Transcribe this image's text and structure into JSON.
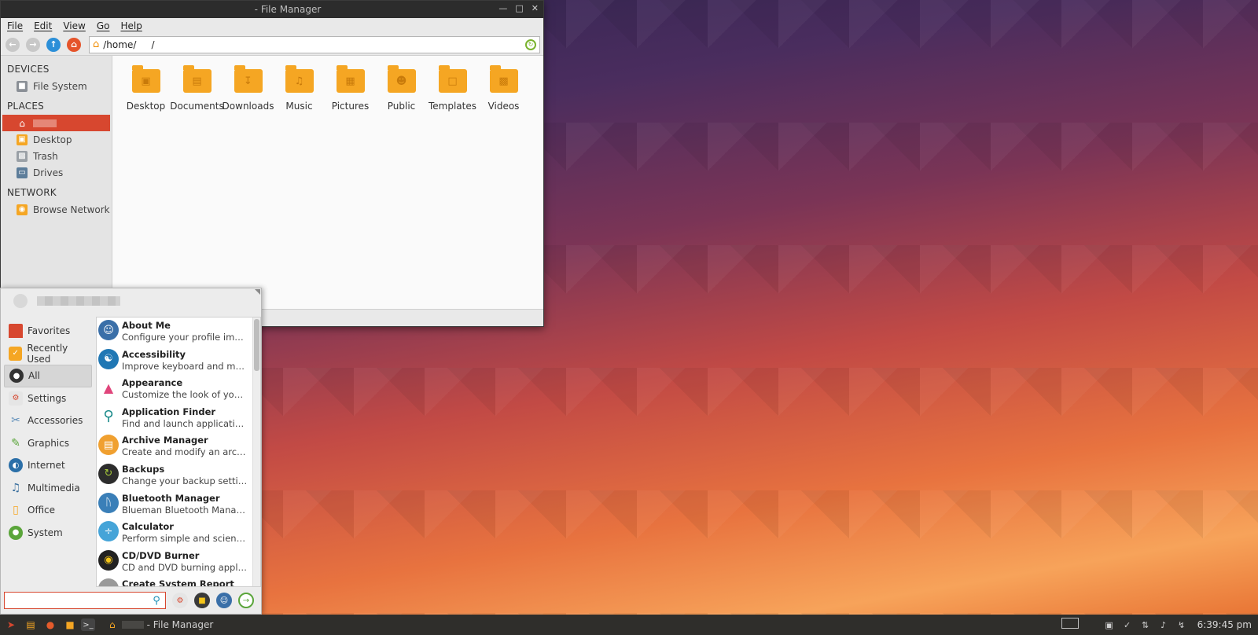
{
  "file_manager": {
    "title": "- File Manager",
    "menu": [
      "File",
      "Edit",
      "View",
      "Go",
      "Help"
    ],
    "location": "/home/     /",
    "sidebar": {
      "devices_heading": "DEVICES",
      "devices": [
        {
          "label": "File System",
          "icon": "drive-icon"
        }
      ],
      "places_heading": "PLACES",
      "places": [
        {
          "label": "Desktop",
          "icon": "desktop-folder-icon"
        },
        {
          "label": "Trash",
          "icon": "trash-icon"
        },
        {
          "label": "Drives",
          "icon": "monitor-icon"
        }
      ],
      "network_heading": "NETWORK",
      "network": [
        {
          "label": "Browse Network",
          "icon": "network-folder-icon"
        }
      ]
    },
    "folders": [
      "Desktop",
      "Documents",
      "Downloads",
      "Music",
      "Pictures",
      "Public",
      "Templates",
      "Videos"
    ]
  },
  "whisker_menu": {
    "categories": [
      "Favorites",
      "Recently Used",
      "All",
      "Settings",
      "Accessories",
      "Graphics",
      "Internet",
      "Multimedia",
      "Office",
      "System"
    ],
    "active_category": "All",
    "apps": [
      {
        "name": "About Me",
        "desc": "Configure your profile image a..."
      },
      {
        "name": "Accessibility",
        "desc": "Improve keyboard and mouse ..."
      },
      {
        "name": "Appearance",
        "desc": "Customize the look of your de..."
      },
      {
        "name": "Application Finder",
        "desc": "Find and launch applications in..."
      },
      {
        "name": "Archive Manager",
        "desc": "Create and modify an archive"
      },
      {
        "name": "Backups",
        "desc": "Change your backup settings"
      },
      {
        "name": "Bluetooth Manager",
        "desc": "Blueman Bluetooth Manager"
      },
      {
        "name": "Calculator",
        "desc": "Perform simple and scientific c..."
      },
      {
        "name": "CD/DVD Burner",
        "desc": "CD and DVD burning application"
      },
      {
        "name": "Create System Report",
        "desc": ""
      }
    ],
    "search_value": ""
  },
  "taskbar": {
    "task_title": "- File Manager",
    "clock": "6:39:45 pm"
  },
  "colors": {
    "accent": "#d7472f",
    "folder": "#f5a623",
    "taskbar": "#2f2e2b"
  }
}
